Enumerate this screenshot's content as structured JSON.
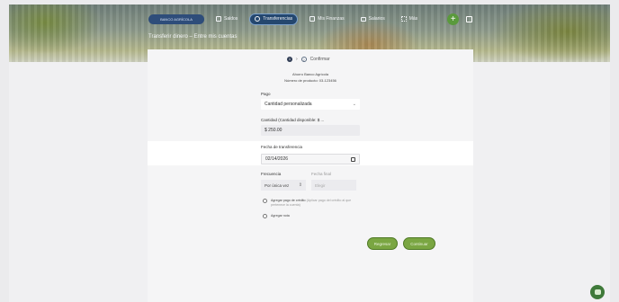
{
  "navbar": {
    "logo": "BANCO AGRÍCOLA",
    "items": [
      {
        "label": "Saldos",
        "icon": "grid-icon",
        "active": false
      },
      {
        "label": "Transferencias",
        "icon": "transfer-icon",
        "active": true
      },
      {
        "label": "Mis Finanzas",
        "icon": "finance-icon",
        "active": false
      },
      {
        "label": "Salarios",
        "icon": "card-icon",
        "active": false
      },
      {
        "label": "Más",
        "icon": "apps-icon",
        "active": false
      }
    ],
    "add_icon": "+"
  },
  "page_title": "Transferir dinero – Entre mis cuentas",
  "steps": {
    "step1": "1",
    "step2": "2",
    "current_label": "Confirmar"
  },
  "account": {
    "name": "Ahorro Banco Agrícola",
    "number": "Número de producto: 03-123456"
  },
  "form": {
    "pago_label": "Pago",
    "pago_value": "Cantidad personalizada",
    "amount_label": "Cantidad (Cantidad disponible: $ ...",
    "amount_value": "$ 250.00",
    "date_label": "Fecha de transferencia",
    "date_value": "02/14/2026",
    "frequency_label": "Frecuencia",
    "frequency_value": "Por única vez",
    "end_date_label": "Fecha final",
    "end_date_value": "Elegir",
    "check1_label": "Agregar pago de crédito",
    "check1_hint": "(Aplicar pago del crédito al que pertenece la cuenta)",
    "check2_label": "Agregar nota"
  },
  "buttons": {
    "back": "Regresar",
    "continue": "Continuar"
  },
  "colors": {
    "accent_green": "#7aa642",
    "nav_active": "#24476f"
  }
}
